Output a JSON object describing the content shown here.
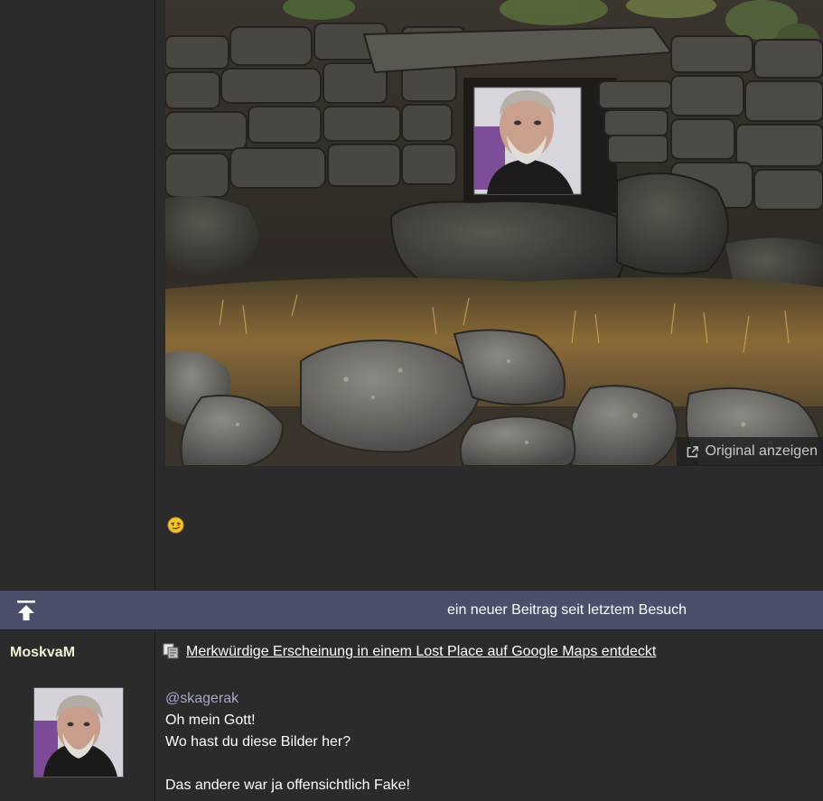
{
  "first_post": {
    "original_link_label": "Original anzeigen",
    "emoji": "smirk-emoji"
  },
  "separator": {
    "text": "ein neuer Beitrag seit letztem Besuch",
    "to_top_icon": "arrow-to-top-icon"
  },
  "second_post": {
    "author": "MoskvaM",
    "topic_title": "Merkwürdige Erscheinung in einem Lost Place auf Google Maps entdeckt",
    "mention": "@skagerak",
    "lines": [
      "Oh mein Gott!",
      "Wo hast du diese Bilder her?",
      "",
      "Das andere war ja offensichtlich Fake!"
    ]
  },
  "colors": {
    "background": "#2b2b2b",
    "separator_bar": "#4b4f6a",
    "username": "#f3efd3",
    "mention": "#a7a9c7"
  }
}
